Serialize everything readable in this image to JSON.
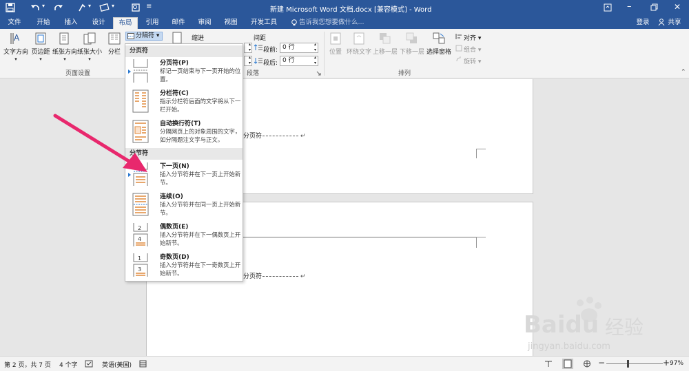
{
  "title_bar": {
    "title": "新建 Microsoft Word 文档.docx [兼容模式] - Word"
  },
  "tabs": [
    {
      "label": "文件"
    },
    {
      "label": "开始"
    },
    {
      "label": "插入"
    },
    {
      "label": "设计"
    },
    {
      "label": "布局"
    },
    {
      "label": "引用"
    },
    {
      "label": "邮件"
    },
    {
      "label": "审阅"
    },
    {
      "label": "视图"
    },
    {
      "label": "开发工具"
    }
  ],
  "tell_me": "告诉我您想要做什么...",
  "login": "登录",
  "share": "共享",
  "ribbon": {
    "text_direction": "文字方向",
    "margins": "页边距",
    "orientation": "纸张方向",
    "size": "纸张大小",
    "columns": "分栏",
    "breaks": "分隔符",
    "page_setup_group": "页面设置",
    "indent": "缩进",
    "spacing": "间距",
    "before_label": "段前:",
    "before_value": "0 行",
    "after_label": "段后:",
    "after_value": "0 行",
    "paragraph_group": "段落",
    "position": "位置",
    "wrap_text": "环绕文字",
    "bring_forward": "上移一层",
    "send_backward": "下移一层",
    "selection_pane": "选择窗格",
    "align": "对齐",
    "group": "组合",
    "rotate": "旋转",
    "arrange_group": "排列"
  },
  "menu": {
    "section_page_breaks": "分页符",
    "section_section_breaks": "分节符",
    "items": [
      {
        "title": "分页符(P)",
        "desc": "标记一页结束与下一页开始的位置。"
      },
      {
        "title": "分栏符(C)",
        "desc": "指示分栏符后面的文字将从下一栏开始。"
      },
      {
        "title": "自动换行符(T)",
        "desc": "分隔网页上的对象周围的文字，如分隔题注文字与正文。"
      },
      {
        "title": "下一页(N)",
        "desc": "插入分节符并在下一页上开始新节。"
      },
      {
        "title": "连续(O)",
        "desc": "插入分节符并在同一页上开始新节。"
      },
      {
        "title": "偶数页(E)",
        "desc": "插入分节符并在下一偶数页上开始新节。"
      },
      {
        "title": "奇数页(D)",
        "desc": "插入分节符并在下一奇数页上开始新节。"
      }
    ]
  },
  "document": {
    "page_break_text_1": "分页符",
    "page_break_text_2": "分页符"
  },
  "status": {
    "page": "第 2 页，共 7 页",
    "words": "4 个字",
    "language": "英语(美国)",
    "zoom": "97%"
  },
  "watermark": {
    "brand": "Baidu",
    "cn": "经验",
    "url": "jingyan.baidu.com"
  },
  "colors": {
    "title_bar": "#2b579a",
    "arrow": "#e8286d"
  }
}
